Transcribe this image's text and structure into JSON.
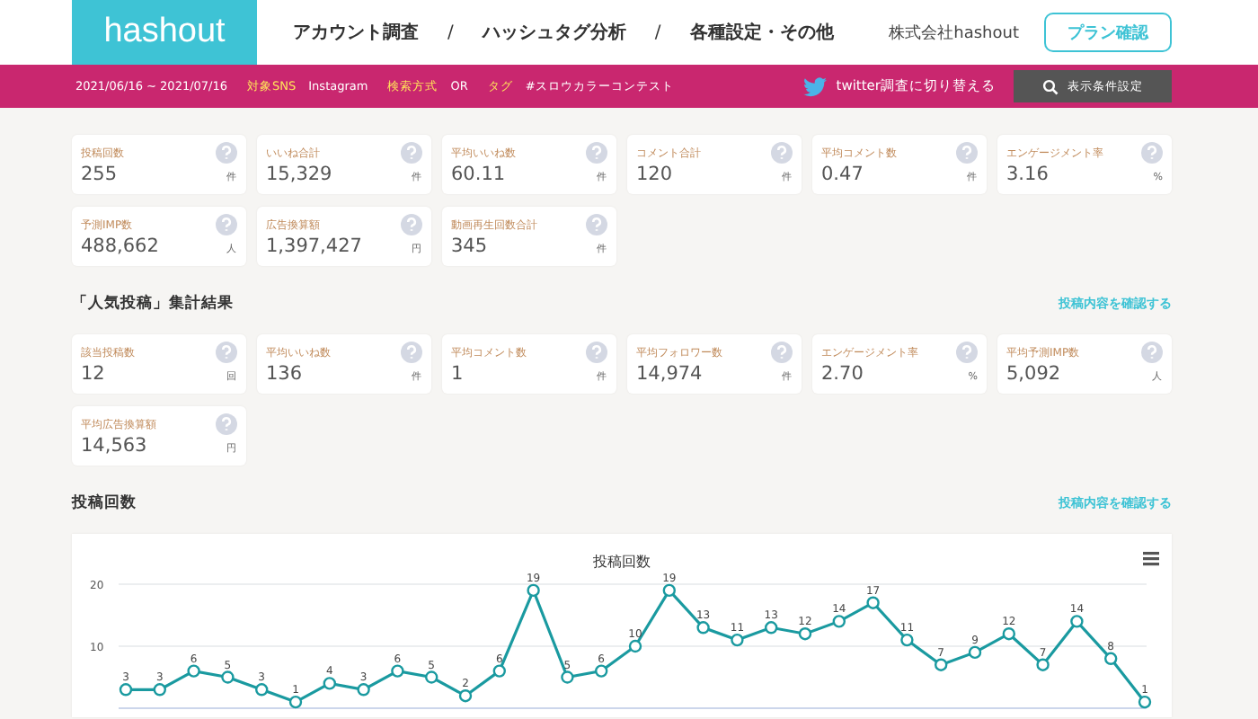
{
  "header": {
    "logo": "hashout",
    "nav": [
      {
        "kind": "link",
        "text": "アカウント調査"
      },
      {
        "kind": "separator",
        "text": "/"
      },
      {
        "kind": "link",
        "text": "ハッシュタグ分析"
      },
      {
        "kind": "separator",
        "text": "/"
      },
      {
        "kind": "link",
        "text": "各種設定・その他"
      }
    ],
    "company": "株式会社hashout",
    "plan_button": "プラン確認"
  },
  "filter_bar": {
    "period": "2021/06/16 ~ 2021/07/16",
    "filters": [
      {
        "label": "対象SNS",
        "value": "Instagram"
      },
      {
        "label": "検索方式",
        "value": "OR"
      },
      {
        "label": "タグ",
        "value": "#スロウカラーコンテスト"
      }
    ],
    "twitter_switch": "twitter調査に切り替える",
    "settings_button": "表示条件設定"
  },
  "summary": {
    "cards": [
      {
        "label": "投稿回数",
        "value": "255",
        "unit": "件"
      },
      {
        "label": "いいね合計",
        "value": "15,329",
        "unit": "件"
      },
      {
        "label": "平均いいね数",
        "value": "60.11",
        "unit": "件"
      },
      {
        "label": "コメント合計",
        "value": "120",
        "unit": "件"
      },
      {
        "label": "平均コメント数",
        "value": "0.47",
        "unit": "件"
      },
      {
        "label": "エンゲージメント率",
        "value": "3.16",
        "unit": "%"
      },
      {
        "label": "予測IMP数",
        "value": "488,662",
        "unit": "人"
      },
      {
        "label": "広告換算額",
        "value": "1,397,427",
        "unit": "円"
      },
      {
        "label": "動画再生回数合計",
        "value": "345",
        "unit": "件"
      }
    ]
  },
  "popular": {
    "title": "「人気投稿」集計結果",
    "link": "投稿内容を確認する",
    "cards": [
      {
        "label": "該当投稿数",
        "value": "12",
        "unit": "回"
      },
      {
        "label": "平均いいね数",
        "value": "136",
        "unit": "件"
      },
      {
        "label": "平均コメント数",
        "value": "1",
        "unit": "件"
      },
      {
        "label": "平均フォロワー数",
        "value": "14,974",
        "unit": "件"
      },
      {
        "label": "エンゲージメント率",
        "value": "2.70",
        "unit": "%"
      },
      {
        "label": "平均予測IMP数",
        "value": "5,092",
        "unit": "人"
      },
      {
        "label": "平均広告換算額",
        "value": "14,563",
        "unit": "円"
      }
    ]
  },
  "posts": {
    "title": "投稿回数",
    "link": "投稿内容を確認する",
    "chart_data": {
      "type": "line",
      "title": "投稿回数",
      "ylim": [
        0,
        20
      ],
      "yticks": [
        10,
        20
      ],
      "data_labels": true,
      "series": [
        {
          "marker": "circle",
          "color": "#1a9aa0",
          "values": [
            3,
            3,
            6,
            5,
            3,
            1,
            4,
            3,
            6,
            5,
            2,
            6,
            19,
            5,
            6,
            10,
            19,
            13,
            11,
            13,
            12,
            14,
            17,
            11,
            7,
            9,
            12,
            7,
            14,
            8,
            1
          ]
        }
      ]
    }
  }
}
